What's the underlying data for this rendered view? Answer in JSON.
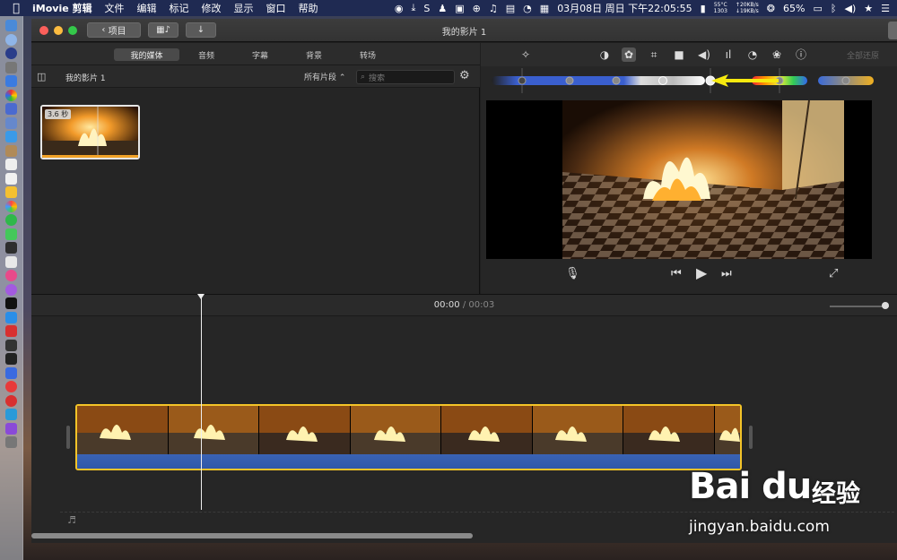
{
  "menubar": {
    "app_name": "iMovie 剪辑",
    "menus": [
      "文件",
      "编辑",
      "标记",
      "修改",
      "显示",
      "窗口",
      "帮助"
    ],
    "temp": "55°C",
    "rpm": "1303",
    "net_up": "↑20KB/s",
    "net_down": "↓19KB/s",
    "datetime": "03月08日 周日 下午22:05:55",
    "battery": "65%"
  },
  "window": {
    "title": "我的影片 1",
    "back_button_label": "项目"
  },
  "browser": {
    "tabs": [
      "我的媒体",
      "音频",
      "字幕",
      "背景",
      "转场"
    ],
    "library_name": "我的影片 1",
    "filter_label": "所有片段",
    "search_placeholder": "搜索",
    "clip_duration": "3.6 秒"
  },
  "viewer": {
    "reset_label": "全部还原"
  },
  "timeline": {
    "current_time": "00:00",
    "separator": "/",
    "total_time": "00:03"
  },
  "watermark": {
    "logo": "Bai du",
    "cn": "经验",
    "url": "jingyan.baidu.com"
  },
  "colors": {
    "menubar_bg": "#1f2a52",
    "clip_selection": "#f4c428",
    "audio_wave": "#3a63b4",
    "slider_blue": "#3a5fcf",
    "arrow_yellow": "#f6e90f"
  }
}
